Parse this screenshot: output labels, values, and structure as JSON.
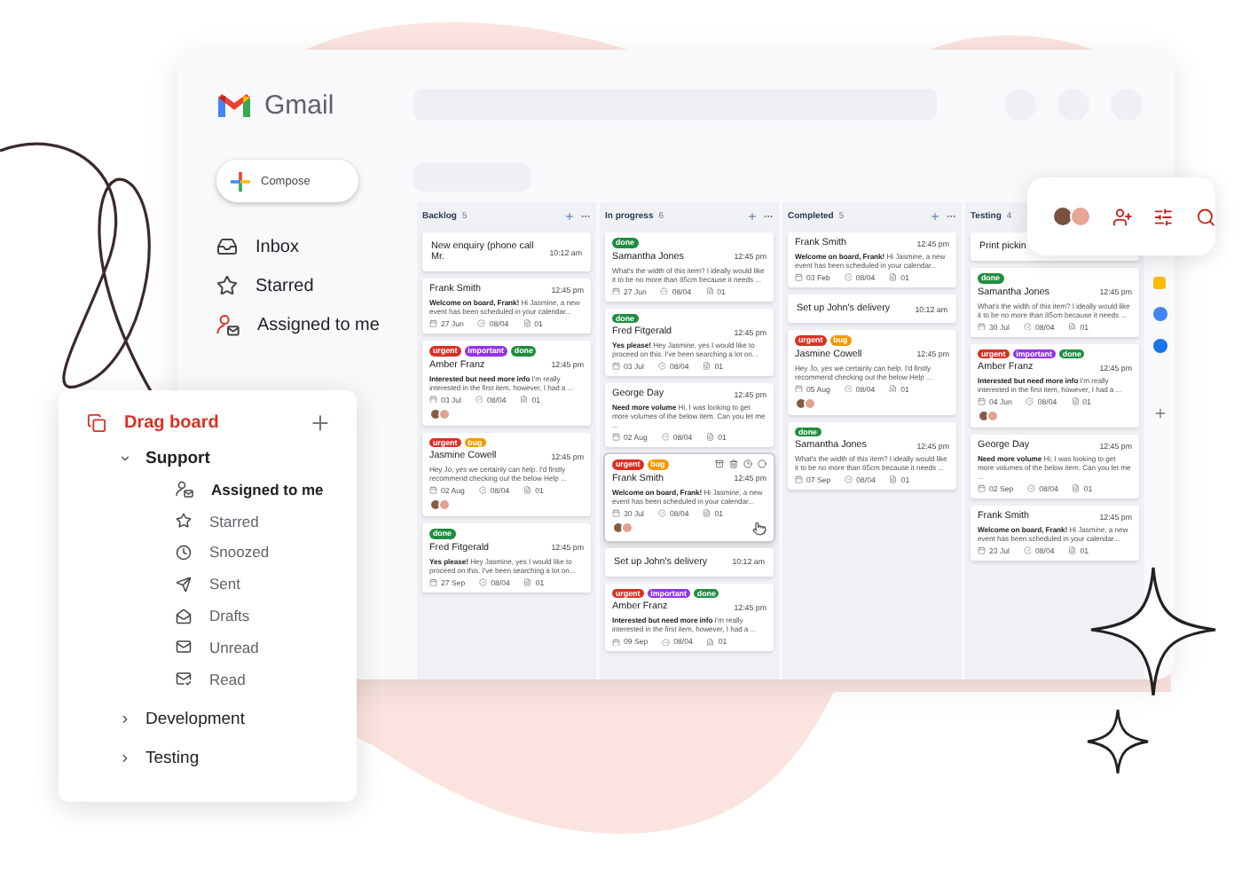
{
  "gmail": {
    "logo": "Gmail",
    "compose": "Compose",
    "nav": [
      {
        "label": "Inbox",
        "selected": false
      },
      {
        "label": "Starred",
        "selected": false
      },
      {
        "label": "Assigned to me",
        "selected": false
      }
    ]
  },
  "board": {
    "columns": [
      {
        "name": "Backlog",
        "count": "5",
        "actions": true,
        "cards": [
          {
            "kind": "task",
            "title": "New enquiry (phone call Mr.",
            "time": "10:12 am"
          },
          {
            "kind": "email",
            "hovered": false,
            "name": "Frank Smith",
            "time": "12:45 pm",
            "preview": "**Welcome on board, Frank!** Hi Jasmine, a new event has been scheduled in your calendar...",
            "date": "27 Jun",
            "check": "08/04",
            "files": "01",
            "assigned": false
          },
          {
            "kind": "email",
            "hovered": false,
            "name": "Amber Franz",
            "time": "12:45 pm",
            "tags": [
              {
                "label": "urgent",
                "color": "#d93025"
              },
              {
                "label": "important",
                "color": "#9334e6"
              },
              {
                "label": "done",
                "color": "#1e8e3e"
              }
            ],
            "preview": "**Interested but need more info** I'm really interested in the first item, however, I had a ...",
            "date": "03 Jul",
            "check": "08/04",
            "files": "01",
            "assigned": true
          },
          {
            "kind": "email",
            "hovered": false,
            "name": "Jasmine Cowell",
            "time": "12:45 pm",
            "tags": [
              {
                "label": "urgent",
                "color": "#d93025"
              },
              {
                "label": "bug",
                "color": "#f29900"
              }
            ],
            "preview": "Hey Jo, yes we certainly can help. I'd firstly recommend checking out the below Help ...",
            "date": "02 Aug",
            "check": "08/04",
            "files": "01",
            "assigned": true
          },
          {
            "kind": "email",
            "hovered": false,
            "name": "Fred Fitgerald",
            "time": "12:45 pm",
            "tags": [
              {
                "label": "done",
                "color": "#1e8e3e"
              }
            ],
            "preview": "**Yes please!** Hey Jasmine, yes I would like to proceed on this. I've been searching a lot on...",
            "date": "27 Sep",
            "check": "08/04",
            "files": "01",
            "assigned": false
          }
        ]
      },
      {
        "name": "In progress",
        "count": "6",
        "actions": true,
        "cards": [
          {
            "kind": "email",
            "hovered": false,
            "name": "Samantha Jones",
            "time": "12:45 pm",
            "tags": [
              {
                "label": "done",
                "color": "#1e8e3e"
              }
            ],
            "preview": "What's the width of this item? I ideally would like it to be no more than 85cm because it needs ...",
            "date": "27 Jun",
            "check": "08/04",
            "files": "01",
            "assigned": false
          },
          {
            "kind": "email",
            "hovered": false,
            "name": "Fred Fitgerald",
            "time": "12:45 pm",
            "tags": [
              {
                "label": "done",
                "color": "#1e8e3e"
              }
            ],
            "preview": "**Yes please!** Hey Jasmine, yes I would like to proceed on this. I've been searching a lot on...",
            "date": "03 Jul",
            "check": "08/04",
            "files": "01",
            "assigned": false
          },
          {
            "kind": "email",
            "hovered": false,
            "name": "George Day",
            "time": "12:45 pm",
            "preview": "**Need more volume** Hi, I was looking to get more volumes of the below item. Can you let me ...",
            "date": "02 Aug",
            "check": "08/04",
            "files": "01",
            "assigned": false
          },
          {
            "kind": "email",
            "hovered": true,
            "name": "Frank Smith",
            "time": "12:45 pm",
            "tags": [
              {
                "label": "urgent",
                "color": "#d93025"
              },
              {
                "label": "bug",
                "color": "#f29900"
              }
            ],
            "preview": "**Welcome on board, Frank!** Hi Jasmine, a new event has been scheduled in your calendar...",
            "date": "30 Jul",
            "check": "08/04",
            "files": "01",
            "assigned": true
          },
          {
            "kind": "task",
            "title": "Set up John's delivery",
            "time": "10:12 am"
          },
          {
            "kind": "email",
            "hovered": false,
            "name": "Amber Franz",
            "time": "12:45 pm",
            "tags": [
              {
                "label": "urgent",
                "color": "#d93025"
              },
              {
                "label": "important",
                "color": "#9334e6"
              },
              {
                "label": "done",
                "color": "#1e8e3e"
              }
            ],
            "preview": "**Interested but need more info** I'm really interested in the first item, however, I had a ...",
            "date": "09 Sep",
            "check": "08/04",
            "files": "01",
            "assigned": false
          }
        ]
      },
      {
        "name": "Completed",
        "count": "5",
        "actions": true,
        "cards": [
          {
            "kind": "email",
            "hovered": false,
            "name": "Frank Smith",
            "time": "12:45 pm",
            "preview": "**Welcome on board, Frank!** Hi Jasmine, a new event has been scheduled in your calendar...",
            "date": "03 Feb",
            "check": "08/04",
            "files": "01",
            "assigned": false
          },
          {
            "kind": "task",
            "title": "Set up John's delivery",
            "time": "10:12 am"
          },
          {
            "kind": "email",
            "hovered": false,
            "name": "Jasmine Cowell",
            "time": "12:45 pm",
            "tags": [
              {
                "label": "urgent",
                "color": "#d93025"
              },
              {
                "label": "bug",
                "color": "#f29900"
              }
            ],
            "preview": "Hey Jo, yes we certainly can help. I'd firstly recommend checking out the below Help ...",
            "date": "05 Aug",
            "check": "08/04",
            "files": "01",
            "assigned": true
          },
          {
            "kind": "email",
            "hovered": false,
            "name": "Samantha Jones",
            "time": "12:45 pm",
            "tags": [
              {
                "label": "done",
                "color": "#1e8e3e"
              }
            ],
            "preview": "What's the width of this item? I ideally would like it to be no more than 85cm because it needs ...",
            "date": "07 Sep",
            "check": "08/04",
            "files": "01",
            "assigned": false
          }
        ]
      },
      {
        "name": "Testing",
        "count": "4",
        "actions": false,
        "cards": [
          {
            "kind": "task",
            "title": "Print pickin"
          },
          {
            "kind": "email",
            "hovered": false,
            "name": "Samantha Jones",
            "time": "12:45 pm",
            "tags": [
              {
                "label": "done",
                "color": "#1e8e3e"
              }
            ],
            "preview": "What's the width of this item? I ideally would like it to be no more than 85cm because it needs ...",
            "date": "30 Jul",
            "check": "08/04",
            "files": "01",
            "assigned": false
          },
          {
            "kind": "email",
            "hovered": false,
            "name": "Amber Franz",
            "time": "12:45 pm",
            "tags": [
              {
                "label": "urgent",
                "color": "#d93025"
              },
              {
                "label": "important",
                "color": "#9334e6"
              },
              {
                "label": "done",
                "color": "#1e8e3e"
              }
            ],
            "preview": "**Interested but need more info** I'm really interested in the first item, however, I had a ...",
            "date": "04 Jun",
            "check": "08/04",
            "files": "01",
            "assigned": true
          },
          {
            "kind": "email",
            "hovered": false,
            "name": "George Day",
            "time": "12:45 pm",
            "preview": "**Need more volume** Hi, I was looking to get more volumes of the below item. Can you let me ...",
            "date": "02 Sep",
            "check": "08/04",
            "files": "01",
            "assigned": false
          },
          {
            "kind": "email",
            "hovered": false,
            "name": "Frank Smith",
            "time": "12:45 pm",
            "preview": "**Welcome on board, Frank!** Hi Jasmine, a new event has been scheduled in your calendar...",
            "date": "23 Jul",
            "check": "08/04",
            "files": "01",
            "assigned": false
          }
        ]
      }
    ]
  },
  "panel": {
    "title": "Drag board",
    "boards": [
      {
        "label": "Support",
        "expanded": true,
        "children": [
          {
            "label": "Assigned to me",
            "selected": true
          },
          {
            "label": "Starred",
            "selected": false
          },
          {
            "label": "Snoozed",
            "selected": false
          },
          {
            "label": "Sent",
            "selected": false
          },
          {
            "label": "Drafts",
            "selected": false
          },
          {
            "label": "Unread",
            "selected": false
          },
          {
            "label": "Read",
            "selected": false
          }
        ]
      },
      {
        "label": "Development",
        "expanded": false
      },
      {
        "label": "Testing",
        "expanded": false
      }
    ]
  }
}
